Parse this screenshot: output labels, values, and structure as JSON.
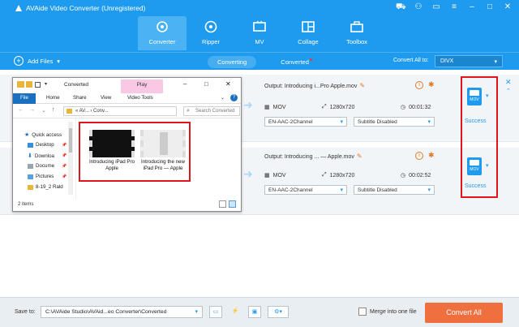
{
  "app": {
    "title": "AVAide Video Converter (Unregistered)",
    "window_controls": [
      "cart-icon",
      "user-icon",
      "chat-icon",
      "menu-icon",
      "minimize-icon",
      "maximize-icon",
      "close-icon"
    ]
  },
  "nav": {
    "tabs": [
      {
        "label": "Converter",
        "icon": "converter-icon",
        "active": true
      },
      {
        "label": "Ripper",
        "icon": "disc-icon",
        "active": false
      },
      {
        "label": "MV",
        "icon": "tv-icon",
        "active": false
      },
      {
        "label": "Collage",
        "icon": "collage-icon",
        "active": false
      },
      {
        "label": "Toolbox",
        "icon": "toolbox-icon",
        "active": false
      }
    ]
  },
  "subbar": {
    "add_files": "Add Files",
    "tabs": {
      "converting": "Converting",
      "converted": "Converted"
    },
    "convert_all_label": "Convert All to:",
    "format": "DIVX"
  },
  "items": [
    {
      "output": "Output: Introducing i...Pro Apple.mov",
      "format": "MOV",
      "resolution": "1280x720",
      "duration": "00:01:32",
      "audio": "EN-AAC-2Channel",
      "subtitle": "Subtitle Disabled",
      "status": "Success",
      "file_badge": "MOV"
    },
    {
      "output": "Output: Introducing ... — Apple.mov",
      "format": "MOV",
      "resolution": "1280x720",
      "duration": "00:02:52",
      "audio": "EN-AAC-2Channel",
      "subtitle": "Subtitle Disabled",
      "status": "Success",
      "file_badge": "MOV"
    }
  ],
  "explorer": {
    "title": "Converted",
    "play_tab": "Play",
    "ribbon": [
      "File",
      "Home",
      "Share",
      "View",
      "Video Tools"
    ],
    "address": "« AV... › Conv...",
    "search_placeholder": "Search Converted",
    "nav": [
      "Quick access",
      "Desktop",
      "Downloa",
      "Docume",
      "Pictures",
      "8-19_2 Rald"
    ],
    "files": [
      {
        "caption": "Introducing iPad Pro Apple"
      },
      {
        "caption": "Introducing the new iPad Pro — Apple"
      }
    ],
    "status": "2 items"
  },
  "bottom": {
    "save_to_label": "Save to:",
    "path": "C:\\AVAide Studio\\AVAid...eo Converter\\Converted",
    "merge_label": "Merge into one file",
    "convert_all": "Convert All"
  },
  "colors": {
    "accent": "#1e9bef",
    "convert_button": "#f06f3f",
    "highlight": "#e3141b"
  }
}
